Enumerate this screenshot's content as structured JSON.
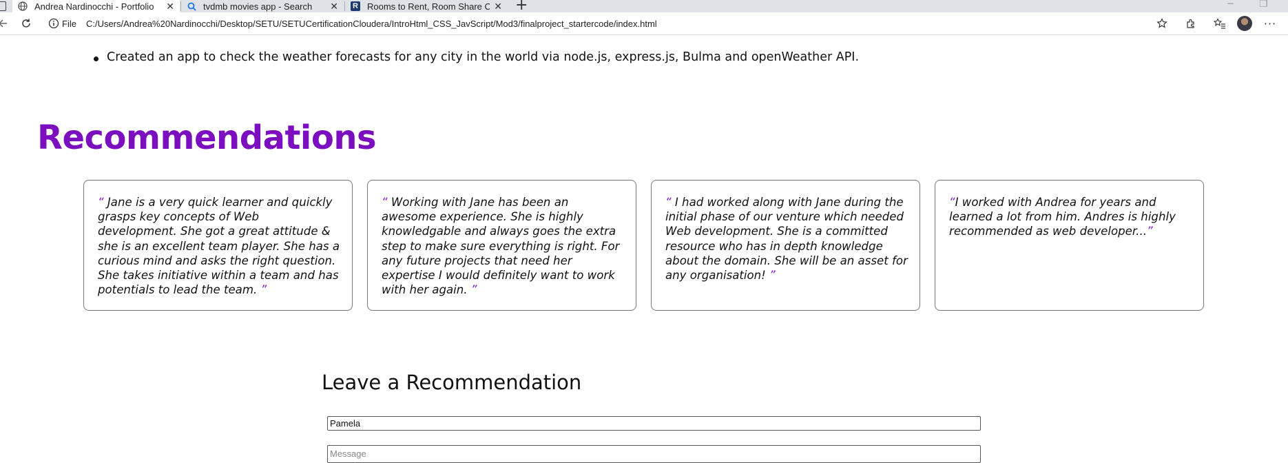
{
  "browser": {
    "tabs": [
      {
        "label": "Andrea Nardinocchi - Portfolio",
        "active": true,
        "icon": "globe-icon"
      },
      {
        "label": "tvdmb movies app - Search",
        "active": false,
        "icon": "search-icon"
      },
      {
        "label": "Rooms to Rent, Room Share Cork",
        "active": false,
        "icon": "r-logo-icon"
      }
    ],
    "address": {
      "scheme_label": "File",
      "url": "C:/Users/Andrea%20Nardinocchi/Desktop/SETU/SETUCertificationCloudera/IntroHtml_CSS_JavScript/Mod3/finalproject_startercode/index.html"
    },
    "accent": "#1a73e8"
  },
  "page": {
    "project_item": "Created an app to check the weather forecasts for any city in the world via node.js, express.js, Bulma and openWeather API.",
    "recommendations": {
      "title": "Recommendations",
      "title_color": "#7b0fbf",
      "open_quote": "“",
      "close_quote": "”",
      "items": [
        {
          "text": " Jane is a very quick learner and quickly grasps key concepts of Web development. She got a great attitude & she is an excellent team player. She has a curious mind and asks the right question. She takes initiative within a team and has potentials to lead the team. "
        },
        {
          "text": " Working with Jane has been an awesome experience. She is highly knowledgable and always goes the extra step to make sure everything is right. For any future projects that need her expertise I would definitely want to work with her again. "
        },
        {
          "text": " I had worked along with Jane during the initial phase of our venture which needed Web development. She is a committed resource who has in depth knowledge about the domain. She will be an asset for any organisation! "
        },
        {
          "text": "I worked with Andrea for years and learned a lot from him. Andres is highly recommended as web developer..."
        }
      ]
    },
    "form": {
      "title": "Leave a Recommendation",
      "name_value": "Pamela",
      "message_placeholder": "Message"
    }
  }
}
